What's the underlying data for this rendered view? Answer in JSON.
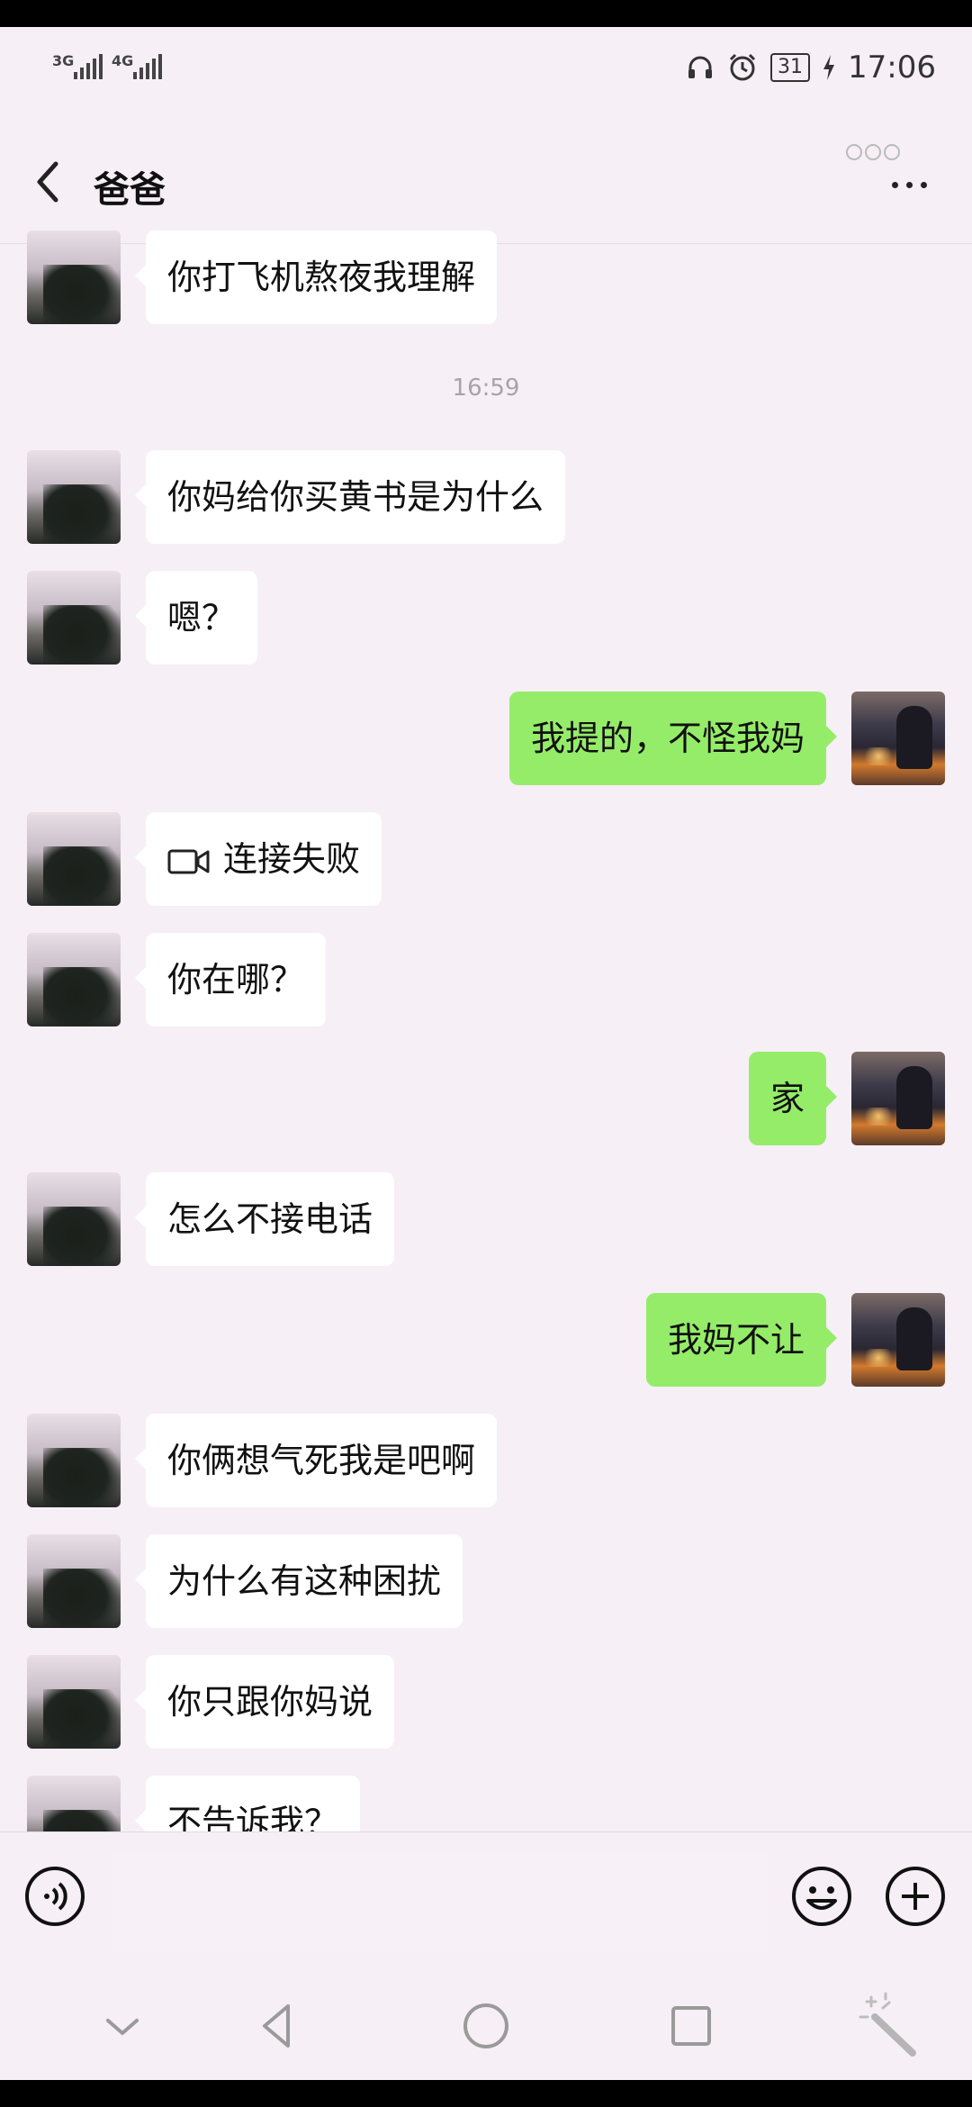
{
  "status_bar": {
    "signal_1": "3G",
    "signal_2": "4G",
    "battery": "31",
    "time": "17:06"
  },
  "header": {
    "title": "爸爸"
  },
  "messages": [
    {
      "side": "left",
      "text": "你打飞机熬夜我理解"
    },
    {
      "side": "left",
      "text": "你妈给你买黄书是为什么"
    },
    {
      "side": "left",
      "text": "嗯？"
    },
    {
      "side": "right",
      "text": "我提的，不怪我妈"
    },
    {
      "side": "left",
      "text": "连接失败",
      "icon": "video-call-icon"
    },
    {
      "side": "left",
      "text": "你在哪？"
    },
    {
      "side": "right",
      "text": "家"
    },
    {
      "side": "left",
      "text": "怎么不接电话"
    },
    {
      "side": "right",
      "text": "我妈不让"
    },
    {
      "side": "left",
      "text": "你俩想气死我是吧啊"
    },
    {
      "side": "left",
      "text": "为什么有这种困扰"
    },
    {
      "side": "left",
      "text": "你只跟你妈说"
    },
    {
      "side": "left",
      "text": "不告诉我？"
    }
  ],
  "timestamp": "16:59",
  "input_bar": {
    "value": "",
    "left_icon": "voice-icon",
    "emoji_icon": "emoji-icon",
    "plus_icon": "plus-icon"
  },
  "system_nav": [
    "collapse-icon",
    "back-triangle-icon",
    "home-circle-icon",
    "recents-square-icon",
    "magic-wand-icon"
  ],
  "colors": {
    "background": "#f6eff6",
    "incoming_bubble": "#ffffff",
    "outgoing_bubble": "#95ec69"
  }
}
